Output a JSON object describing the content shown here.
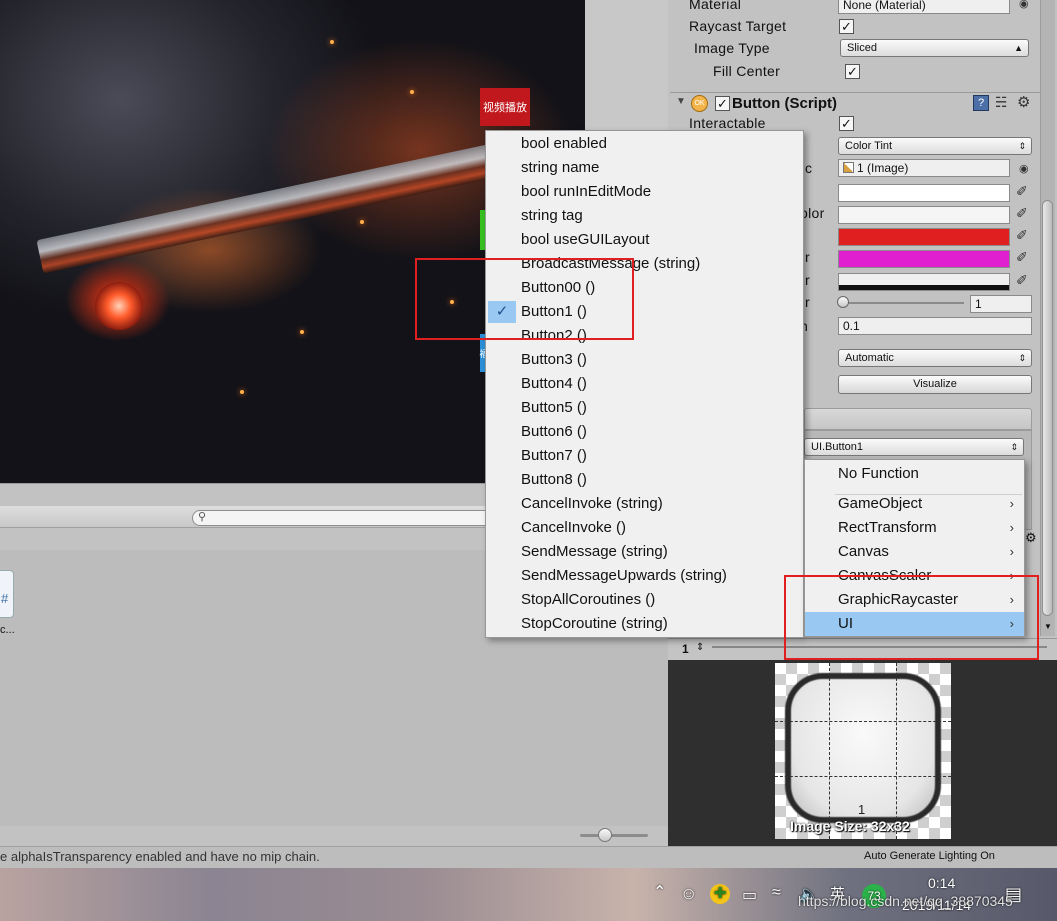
{
  "scene": {
    "play_button_label": "视频播放",
    "side_button_blue_label": "福"
  },
  "inspector": {
    "material_label": "Material",
    "material_value": "None (Material)",
    "raycast_label": "Raycast Target",
    "image_type_label": "Image Type",
    "image_type_value": "Sliced",
    "fill_center_label": "Fill Center",
    "component_title": "Button (Script)",
    "interactable_label": "Interactable",
    "transition_value": "Color Tint",
    "target_graphic_partial": "c",
    "target_graphic_value": "1 (Image)",
    "color_label_partial": "olor",
    "label_r1": "r",
    "label_r2": "r",
    "label_r3": "r",
    "label_r4": "r",
    "label_n": "n",
    "multiplier_value": "1",
    "fade_value": "0.1",
    "navigation_value": "Automatic",
    "visualize_label": "Visualize",
    "onclick_function": "UI.Button1",
    "colors": {
      "normal": "#ffffff",
      "highlighted": "#f5f5f5",
      "pressed": "#e02020",
      "selected": "#e020d0"
    }
  },
  "context_menu": {
    "items": [
      "bool enabled",
      "string name",
      "bool runInEditMode",
      "string tag",
      "bool useGUILayout",
      "BroadcastMessage (string)",
      "Button00 ()",
      "Button1 ()",
      "Button2 ()",
      "Button3 ()",
      "Button4 ()",
      "Button5 ()",
      "Button6 ()",
      "Button7 ()",
      "Button8 ()",
      "CancelInvoke (string)",
      "CancelInvoke ()",
      "SendMessage (string)",
      "SendMessageUpwards (string)",
      "StopAllCoroutines ()",
      "StopCoroutine (string)"
    ],
    "checked_item": "Button1 ()"
  },
  "sub_menu": {
    "no_function": "No Function",
    "items": [
      "GameObject",
      "RectTransform",
      "Canvas",
      "CanvasScaler",
      "GraphicRaycaster",
      "UI"
    ],
    "highlighted": "UI"
  },
  "preview": {
    "index_label": "1",
    "caption": "Image Size: 32x32",
    "center_label": "1"
  },
  "project": {
    "file_label": "c..."
  },
  "status": {
    "message": "e alphaIsTransparency enabled and have no mip chain.",
    "right": "Auto Generate Lighting On"
  },
  "taskbar": {
    "time": "0:14",
    "date": "2019/11/14",
    "ime": "英",
    "badge": "73",
    "watermark": "https://blog.csdn.net/qq_38870345"
  }
}
